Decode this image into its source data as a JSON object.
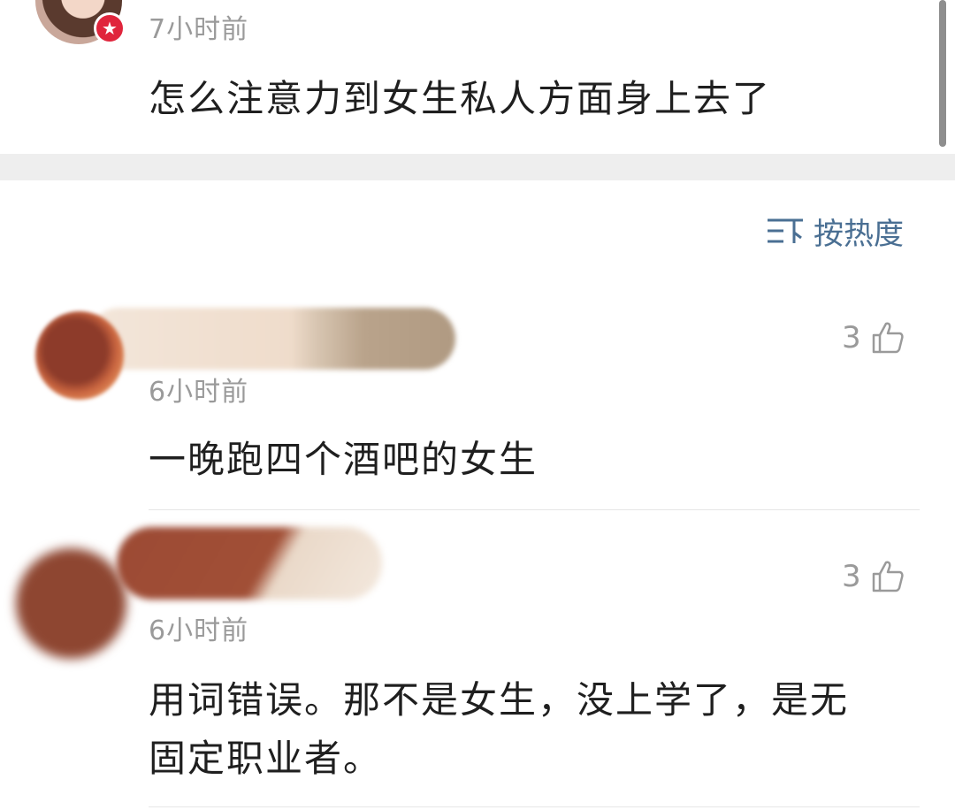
{
  "top_comment": {
    "time": "7小时前",
    "text": "怎么注意力到女生私人方面身上去了"
  },
  "sort": {
    "label": "按热度"
  },
  "comments": [
    {
      "time": "6小时前",
      "likes": "3",
      "text": "一晚跑四个酒吧的女生"
    },
    {
      "time": "6小时前",
      "likes": "3",
      "text_line1": "用词错误。那不是女生，没上学了，是无",
      "text_line2": "固定职业者。"
    }
  ]
}
